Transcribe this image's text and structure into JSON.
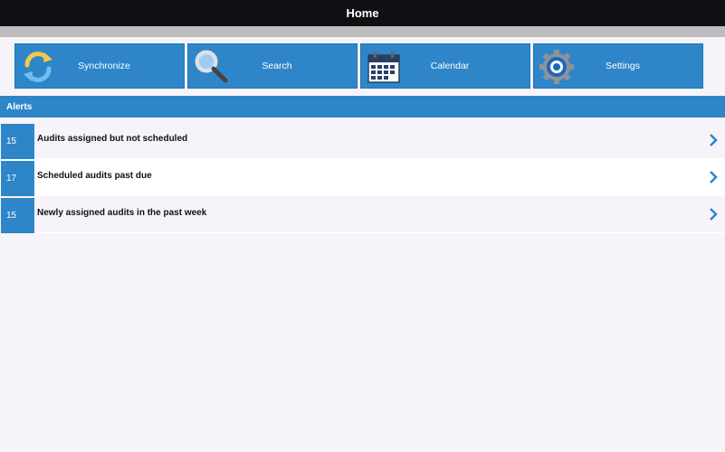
{
  "header": {
    "title": "Home"
  },
  "toolbar": {
    "synchronize_label": "Synchronize",
    "search_label": "Search",
    "calendar_label": "Calendar",
    "settings_label": "Settings"
  },
  "alerts": {
    "title": "Alerts",
    "items": [
      {
        "count": "15",
        "label": "Audits assigned but not scheduled"
      },
      {
        "count": "17",
        "label": "Scheduled audits past due"
      },
      {
        "count": "15",
        "label": "Newly assigned audits in the past week"
      }
    ]
  },
  "colors": {
    "accent": "#2e86c9",
    "titlebar": "#101014",
    "background": "#f6f3f9"
  },
  "icons": {
    "synchronize": "sync-icon",
    "search": "magnifier-icon",
    "calendar": "calendar-icon",
    "settings": "gear-icon",
    "row_arrow": "chevron-right-icon"
  }
}
